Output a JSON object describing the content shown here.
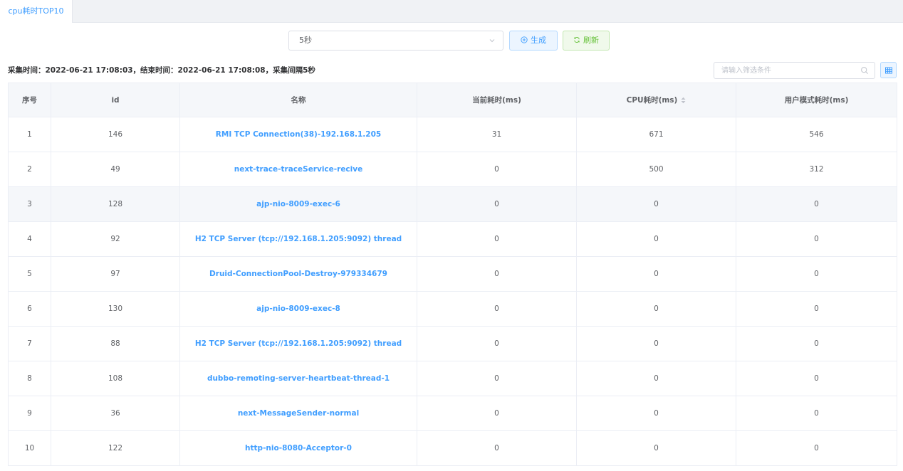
{
  "tabs": [
    {
      "label": "cpu耗时TOP10",
      "active": true
    }
  ],
  "toolbar": {
    "interval_value": "5秒",
    "generate_label": "生成",
    "refresh_label": "刷新"
  },
  "info_text": "采集时间：2022-06-21 17:08:03，结束时间：2022-06-21 17:08:08，采集间隔5秒",
  "filter": {
    "placeholder": "请输入筛选条件"
  },
  "table": {
    "headers": [
      "序号",
      "id",
      "名称",
      "当前耗时(ms)",
      "CPU耗时(ms)",
      "用户模式耗时(ms)"
    ],
    "sortable_column": "CPU耗时(ms)",
    "hover_row": 3,
    "rows": [
      [
        "1",
        "146",
        "RMI TCP Connection(38)-192.168.1.205",
        "31",
        "671",
        "546"
      ],
      [
        "2",
        "49",
        "next-trace-traceService-recive",
        "0",
        "500",
        "312"
      ],
      [
        "3",
        "128",
        "ajp-nio-8009-exec-6",
        "0",
        "0",
        "0"
      ],
      [
        "4",
        "92",
        "H2 TCP Server (tcp://192.168.1.205:9092) thread",
        "0",
        "0",
        "0"
      ],
      [
        "5",
        "97",
        "Druid-ConnectionPool-Destroy-979334679",
        "0",
        "0",
        "0"
      ],
      [
        "6",
        "130",
        "ajp-nio-8009-exec-8",
        "0",
        "0",
        "0"
      ],
      [
        "7",
        "88",
        "H2 TCP Server (tcp://192.168.1.205:9092) thread",
        "0",
        "0",
        "0"
      ],
      [
        "8",
        "108",
        "dubbo-remoting-server-heartbeat-thread-1",
        "0",
        "0",
        "0"
      ],
      [
        "9",
        "36",
        "next-MessageSender-normal",
        "0",
        "0",
        "0"
      ],
      [
        "10",
        "122",
        "http-nio-8080-Acceptor-0",
        "0",
        "0",
        "0"
      ]
    ]
  },
  "colors": {
    "primary": "#409eff",
    "success": "#67c23a",
    "header_bg": "#f5f7fa",
    "border": "#ebeef5"
  },
  "icons": [
    "chevron-down-icon",
    "plus-circle-icon",
    "refresh-icon",
    "search-icon",
    "table-columns-icon",
    "sort-caret-icon"
  ]
}
